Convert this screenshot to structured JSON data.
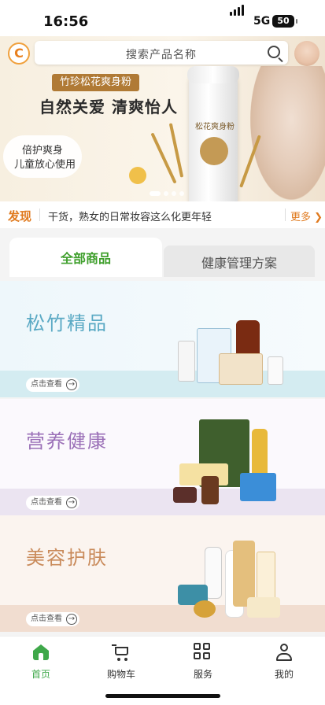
{
  "status_bar": {
    "time": "16:56",
    "network": "5G",
    "battery": "50"
  },
  "search": {
    "placeholder": "搜索产品名称"
  },
  "banner": {
    "product_tag": "竹珍松花爽身粉",
    "slogan": "自然关爱 清爽怡人",
    "sub_line1": "倍护爽身",
    "sub_line2": "儿童放心使用",
    "bottle_label": "松花爽身粉",
    "page_dots": 4,
    "active_dot": 0
  },
  "discover": {
    "tag": "发现",
    "headline": "干货，熟女的日常妆容这么化更年轻",
    "more": "更多"
  },
  "tabs": {
    "all_products": "全部商品",
    "health_plan": "健康管理方案"
  },
  "categories": [
    {
      "title": "松竹精品",
      "button": "点击查看"
    },
    {
      "title": "营养健康",
      "button": "点击查看"
    },
    {
      "title": "美容护肤",
      "button": "点击查看"
    }
  ],
  "tabbar": {
    "items": [
      {
        "label": "首页",
        "icon": "home-icon",
        "active": true
      },
      {
        "label": "购物车",
        "icon": "cart-icon",
        "active": false
      },
      {
        "label": "服务",
        "icon": "grid-icon",
        "active": false
      },
      {
        "label": "我的",
        "icon": "user-icon",
        "active": false
      }
    ]
  },
  "colors": {
    "accent_green": "#3fa84a",
    "discover_orange": "#e07a1e",
    "title_blue": "#5aa9c4",
    "title_purple": "#9a6fb7",
    "title_tan": "#c98a5a"
  }
}
